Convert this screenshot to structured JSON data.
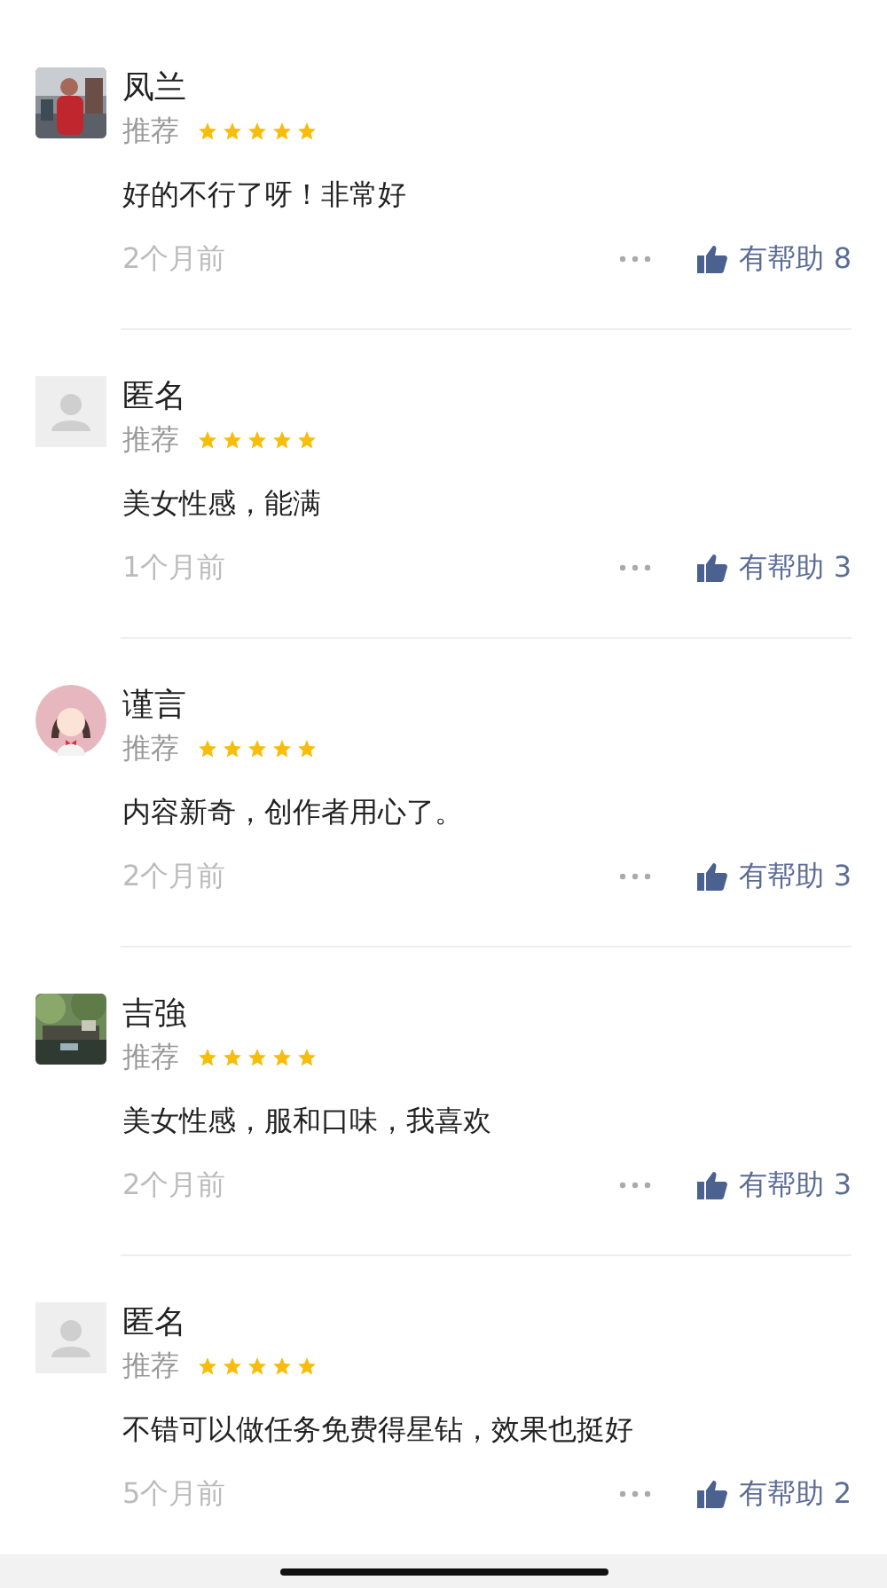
{
  "reviews": [
    {
      "name": "凤兰",
      "tag": "推荐",
      "stars": 5,
      "content": "好的不行了呀！非常好",
      "time": "2个月前",
      "helpful_label": "有帮助",
      "helpful_count": "8"
    },
    {
      "avatar": {
        "kind": "default"
      },
      "name": "匿名",
      "tag": "推荐",
      "stars": 5,
      "content": "美女性感，能满",
      "time": "1个月前",
      "helpful_label": "有帮助",
      "helpful_count": "3"
    },
    {
      "avatar": {
        "kind": "illustration"
      },
      "name": "谨言",
      "tag": "推荐",
      "stars": 5,
      "content": "内容新奇，创作者用心了。",
      "time": "2个月前",
      "helpful_label": "有帮助",
      "helpful_count": "3"
    },
    {
      "avatar": {
        "kind": "landscape"
      },
      "name": "吉強",
      "tag": "推荐",
      "stars": 5,
      "content": "美女性感，服和口味，我喜欢",
      "time": "2个月前",
      "helpful_label": "有帮助",
      "helpful_count": "3"
    },
    {
      "avatar": {
        "kind": "default"
      },
      "name": "匿名",
      "tag": "推荐",
      "stars": 5,
      "content": "不错可以做任务免费得星钻，效果也挺好",
      "time": "5个月前",
      "helpful_label": "有帮助",
      "helpful_count": "2"
    }
  ]
}
